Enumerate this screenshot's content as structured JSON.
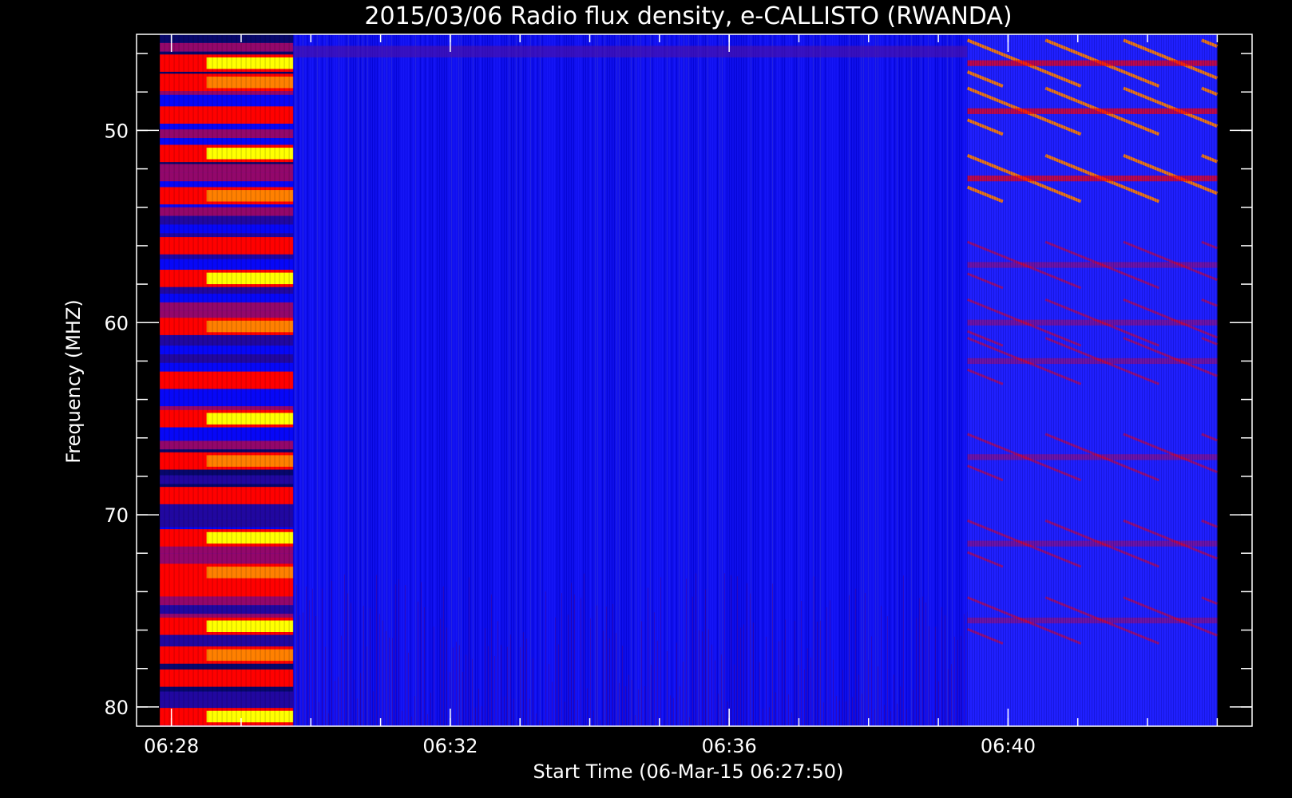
{
  "chart_data": {
    "type": "heatmap",
    "title": "2015/03/06  Radio flux density, e-CALLISTO (RWANDA)",
    "xlabel": "Start Time (06-Mar-15 06:27:50)",
    "ylabel": "Frequency (MHZ)",
    "x_ticks": [
      "06:28",
      "06:32",
      "06:36",
      "06:40"
    ],
    "y_ticks": [
      50,
      60,
      70,
      80
    ],
    "x_range_minutes_after_0627": [
      0.5,
      16.5
    ],
    "y_range_mhz": [
      45,
      81
    ],
    "y_axis_inverted": true,
    "data_time_range": [
      "06:27:50",
      "06:43:00"
    ],
    "data_freq_range_mhz": [
      45.0,
      81.0
    ],
    "colormap": [
      "#000000",
      "#0000ff",
      "#ff0000",
      "#ff8000",
      "#ffff00",
      "#ffffff"
    ],
    "background_color": "#1010ee",
    "intervals": [
      {
        "start": "06:27:50",
        "end": "06:29:45",
        "character": "intense broadband horizontal banding (red, orange, yellow)"
      },
      {
        "start": "06:29:45",
        "end": "06:39:25",
        "character": "quiet background (blue)"
      },
      {
        "start": "06:39:25",
        "end": "06:43:00",
        "character": "drifting diagonal red stripes"
      }
    ],
    "bright_bands_mhz_first_interval": [
      46.5,
      47.5,
      49.2,
      51.2,
      53.4,
      56.0,
      57.7,
      60.2,
      63.0,
      65.0,
      67.2,
      69.0,
      71.2,
      73.0,
      73.8,
      75.8,
      77.3,
      78.5,
      80.5
    ],
    "drift_band_centers_mhz_last_interval": [
      46.5,
      49.0,
      52.5,
      57.0,
      60.0,
      62.0,
      67.0,
      71.5,
      75.5
    ]
  }
}
